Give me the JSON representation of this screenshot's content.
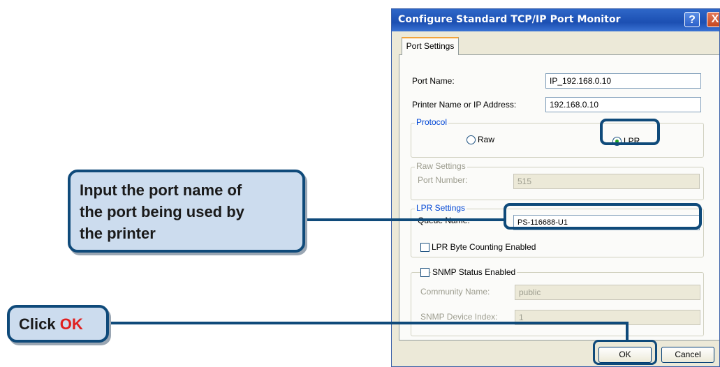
{
  "dialog": {
    "title": "Configure Standard TCP/IP Port Monitor",
    "help_label": "?",
    "close_label": "X",
    "tab_label": "Port Settings",
    "port_name_label": "Port Name:",
    "port_name_value": "IP_192.168.0.10",
    "printer_label": "Printer Name or IP Address:",
    "printer_value": "192.168.0.10",
    "protocol_group": "Protocol",
    "raw_label": "Raw",
    "lpr_label": "LPR",
    "raw_settings_group": "Raw Settings",
    "port_number_label": "Port Number:",
    "port_number_value": "515",
    "lpr_settings_group": "LPR Settings",
    "queue_name_label": "Queue Name:",
    "queue_name_value": "PS-116688-U1",
    "lpr_byte_counting_label": "LPR Byte Counting Enabled",
    "snmp_status_label": "SNMP Status Enabled",
    "community_name_label": "Community Name:",
    "community_name_value": "public",
    "snmp_index_label": "SNMP Device Index:",
    "snmp_index_value": "1",
    "ok_label": "OK",
    "cancel_label": "Cancel"
  },
  "callouts": {
    "port_note_line1": "Input the port name of",
    "port_note_line2": "the port being used by",
    "port_note_line3": "the printer",
    "click_prefix": "Click ",
    "click_target": "OK"
  },
  "colors": {
    "highlight": "#0f4a7a",
    "callout_fill": "#ccdcee",
    "emphasis_red": "#e02020"
  }
}
